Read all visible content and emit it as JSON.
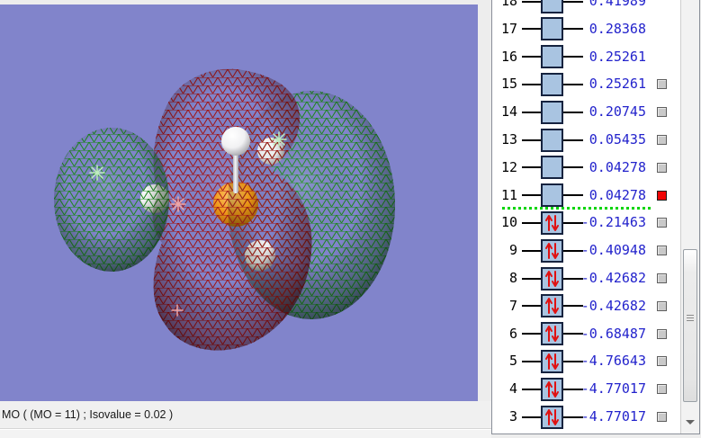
{
  "viewport": {
    "background_color": "#8184cb",
    "status_text": "MO ( (MO = 11) ; Isovalue = 0.02 )",
    "positive_lobe_color": "#1d8a1d",
    "negative_lobe_color": "#a31313",
    "atom_colors": {
      "hydrogen": "#ffffff",
      "phosphorus": "#f29b13"
    }
  },
  "mo_panel": {
    "energy_color": "#2323cc",
    "level_box_fill": "#a9c4e1",
    "electron_arrow_color": "#e01111",
    "homo_lumo_separator_color": "#00d400",
    "checkbox_color": "#c9c9c9",
    "selected_checkbox_color": "#f00505",
    "separator_after_row": "11",
    "rows": [
      {
        "index": "18",
        "energy": "0.41989",
        "occupied": false,
        "has_checkbox": false,
        "selected": false
      },
      {
        "index": "17",
        "energy": "0.28368",
        "occupied": false,
        "has_checkbox": false,
        "selected": false
      },
      {
        "index": "16",
        "energy": "0.25261",
        "occupied": false,
        "has_checkbox": false,
        "selected": false
      },
      {
        "index": "15",
        "energy": "0.25261",
        "occupied": false,
        "has_checkbox": true,
        "selected": false
      },
      {
        "index": "14",
        "energy": "0.20745",
        "occupied": false,
        "has_checkbox": true,
        "selected": false
      },
      {
        "index": "13",
        "energy": "0.05435",
        "occupied": false,
        "has_checkbox": true,
        "selected": false
      },
      {
        "index": "12",
        "energy": "0.04278",
        "occupied": false,
        "has_checkbox": true,
        "selected": false
      },
      {
        "index": "11",
        "energy": "0.04278",
        "occupied": false,
        "has_checkbox": true,
        "selected": true
      },
      {
        "index": "10",
        "energy": "-0.21463",
        "occupied": true,
        "has_checkbox": true,
        "selected": false
      },
      {
        "index": "9",
        "energy": "-0.40948",
        "occupied": true,
        "has_checkbox": true,
        "selected": false
      },
      {
        "index": "8",
        "energy": "-0.42682",
        "occupied": true,
        "has_checkbox": true,
        "selected": false
      },
      {
        "index": "7",
        "energy": "-0.42682",
        "occupied": true,
        "has_checkbox": true,
        "selected": false
      },
      {
        "index": "6",
        "energy": "-0.68487",
        "occupied": true,
        "has_checkbox": true,
        "selected": false
      },
      {
        "index": "5",
        "energy": "-4.76643",
        "occupied": true,
        "has_checkbox": true,
        "selected": false
      },
      {
        "index": "4",
        "energy": "-4.77017",
        "occupied": true,
        "has_checkbox": true,
        "selected": false
      },
      {
        "index": "3",
        "energy": "-4.77017",
        "occupied": true,
        "has_checkbox": true,
        "selected": false
      }
    ]
  },
  "scrollbar": {
    "down_arrow": "chevron-down"
  }
}
